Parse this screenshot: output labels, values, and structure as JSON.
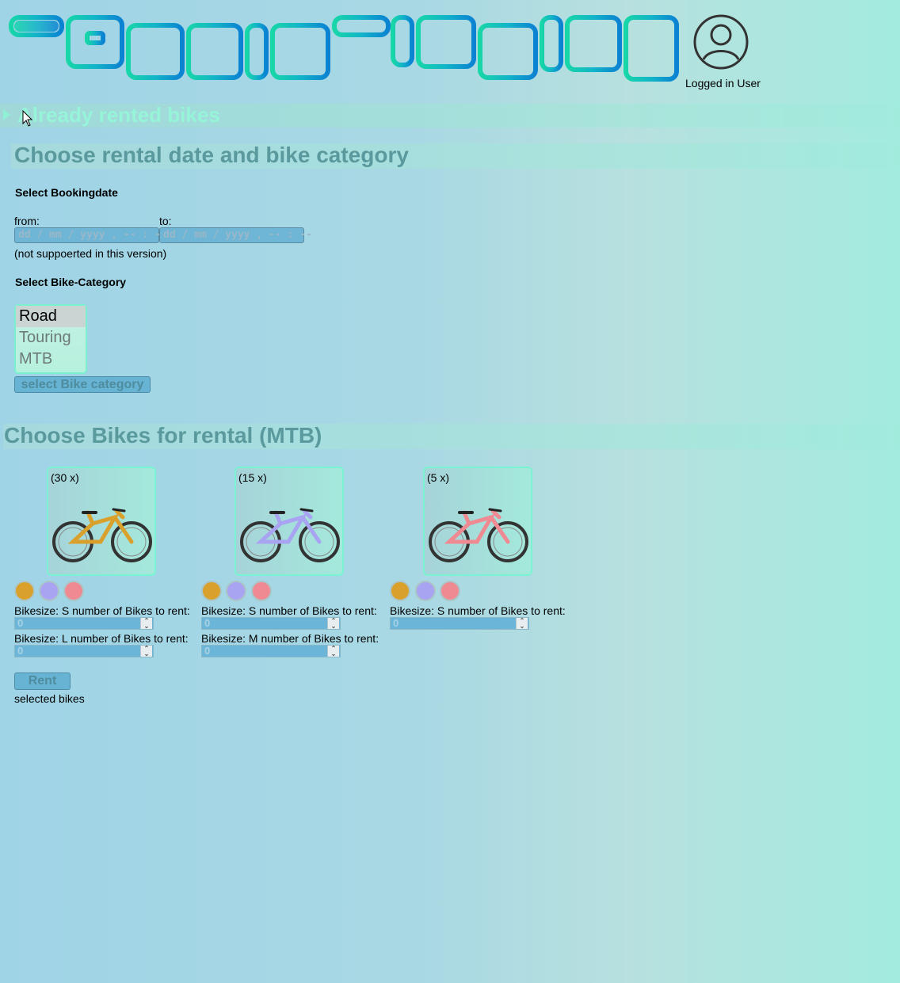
{
  "header": {
    "logo_text": "TOURISTIKBIKE",
    "user_label": "Logged in User"
  },
  "rented": {
    "summary": "Already rented bikes"
  },
  "booking": {
    "section_title": "Choose rental date and bike category",
    "date_heading": "Select Bookingdate",
    "from_label": "from:",
    "to_label": "to:",
    "from_placeholder": "dd / mm / yyyy ,  -- : --",
    "to_placeholder": "dd / mm / yyyy ,  -- : --",
    "note": "(not suppoerted in this version)",
    "category_heading": "Select Bike-Category",
    "categories": [
      "Road",
      "Touring",
      "MTB"
    ],
    "selected_category": "Road",
    "select_button": "select Bike category"
  },
  "bikes": {
    "section_title": "Choose Bikes for rental (MTB)",
    "items": [
      {
        "count": "(30 x)",
        "frame_color": "#d9a12c",
        "swatches": [
          "#d9a12c",
          "#a9a4f2",
          "#ef8a93"
        ],
        "sizes": [
          {
            "label": "Bikesize: S number of Bikes to rent:",
            "value": "0"
          },
          {
            "label": "Bikesize: L number of Bikes to rent:",
            "value": "0"
          }
        ]
      },
      {
        "count": "(15 x)",
        "frame_color": "#a9a4f2",
        "swatches": [
          "#d9a12c",
          "#a9a4f2",
          "#ef8a93"
        ],
        "sizes": [
          {
            "label": "Bikesize: S number of Bikes to rent:",
            "value": "0"
          },
          {
            "label": "Bikesize: M number of Bikes to rent:",
            "value": "0"
          }
        ]
      },
      {
        "count": "(5 x)",
        "frame_color": "#ef8a93",
        "swatches": [
          "#d9a12c",
          "#a9a4f2",
          "#ef8a93"
        ],
        "sizes": [
          {
            "label": "Bikesize: S number of Bikes to rent:",
            "value": "0"
          }
        ]
      }
    ],
    "rent_button": "Rent",
    "selected_text": "selected bikes"
  }
}
